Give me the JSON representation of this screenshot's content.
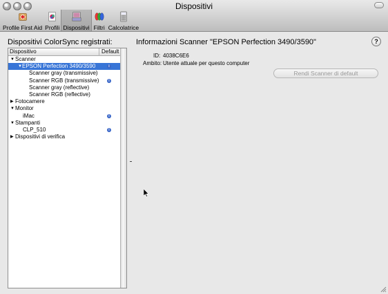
{
  "window": {
    "title": "Dispositivi"
  },
  "toolbar": {
    "items": [
      {
        "label": "Profile First Aid",
        "icon": "profile-first-aid-icon"
      },
      {
        "label": "Profili",
        "icon": "profiles-icon"
      },
      {
        "label": "Dispositivi",
        "icon": "devices-icon",
        "selected": true
      },
      {
        "label": "Filtri",
        "icon": "filters-icon"
      },
      {
        "label": "Calcolatrice",
        "icon": "calculator-icon"
      }
    ]
  },
  "left": {
    "heading": "Dispositivi ColorSync registrati:",
    "columns": {
      "device": "Dispositivo",
      "default": "Default"
    },
    "rows": [
      {
        "label": "Scanner",
        "level": 0,
        "expander": "open"
      },
      {
        "label": "EPSON Perfection 3490/3590",
        "level": 1,
        "expander": "open",
        "selected": true,
        "default": true
      },
      {
        "label": "Scanner gray (transmissive)",
        "level": 2
      },
      {
        "label": "Scanner RGB (transmissive)",
        "level": 2,
        "default": true
      },
      {
        "label": "Scanner gray (reflective)",
        "level": 2
      },
      {
        "label": "Scanner RGB (reflective)",
        "level": 2
      },
      {
        "label": "Fotocamere",
        "level": 0,
        "expander": "closed"
      },
      {
        "label": "Monitor",
        "level": 0,
        "expander": "open"
      },
      {
        "label": "iMac",
        "level": 1,
        "default": true
      },
      {
        "label": "Stampanti",
        "level": 0,
        "expander": "open"
      },
      {
        "label": "CLP_510",
        "level": 1,
        "default": true
      },
      {
        "label": "Dispositivi di verifica",
        "level": 0,
        "expander": "closed"
      }
    ]
  },
  "right": {
    "title": "Informazioni Scanner \"EPSON Perfection 3490/3590\"",
    "id_label": "ID:",
    "id_value": "4038C6E6",
    "scope_label": "Ambito:",
    "scope_value": "Utente attuale per questo computer",
    "default_button": "Rendi Scanner di default",
    "help": "?"
  },
  "colors": {
    "selection": "#3875d7",
    "info_badge": "#3a67c8"
  }
}
